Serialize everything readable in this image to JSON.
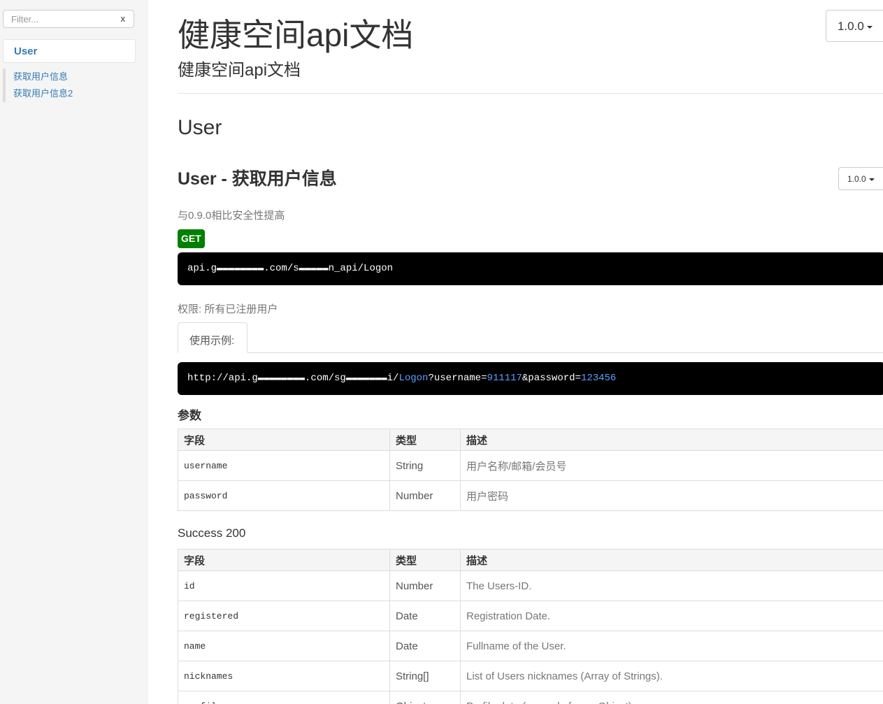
{
  "sidebar": {
    "filter_placeholder": "Filter...",
    "filter_clear": "x",
    "group": "User",
    "items": [
      {
        "label": "获取用户信息"
      },
      {
        "label": "获取用户信息2"
      }
    ]
  },
  "header": {
    "title": "健康空间api文档",
    "subtitle": "健康空间api文档",
    "version": "1.0.0"
  },
  "section": {
    "title": "User"
  },
  "api": {
    "title": "User - 获取用户信息",
    "version": "1.0.0",
    "description": "与0.9.0相比安全性提高",
    "method": "GET",
    "endpoint": "api.g▬▬▬▬▬▬▬▬.com/s▬▬▬▬▬n_api/Logon",
    "permission": "权限: 所有已注册用户",
    "example_tab": "使用示例:",
    "example": {
      "prefix": "http://api.g▬▬▬▬▬▬▬▬.com/sg▬▬▬▬▬▬▬i/",
      "path": "Logon",
      "q1": "?username=",
      "v1": "911117",
      "q2": "&password=",
      "v2": "123456"
    },
    "params_title": "参数",
    "success_title": "Success 200",
    "columns": {
      "field": "字段",
      "type": "类型",
      "desc": "描述"
    },
    "params": [
      {
        "field": "username",
        "type": "String",
        "desc": "用户名称/邮箱/会员号"
      },
      {
        "field": "password",
        "type": "Number",
        "desc": "用户密码"
      }
    ],
    "success": [
      {
        "field": "id",
        "type": "Number",
        "desc": "The Users-ID."
      },
      {
        "field": "registered",
        "type": "Date",
        "desc": "Registration Date."
      },
      {
        "field": "name",
        "type": "Date",
        "desc": "Fullname of the User."
      },
      {
        "field": "nicknames",
        "type": "String[]",
        "desc": "List of Users nicknames (Array of Strings)."
      },
      {
        "field": "profile",
        "type": "Object",
        "desc": "Profile data (example for an Object)"
      }
    ]
  }
}
